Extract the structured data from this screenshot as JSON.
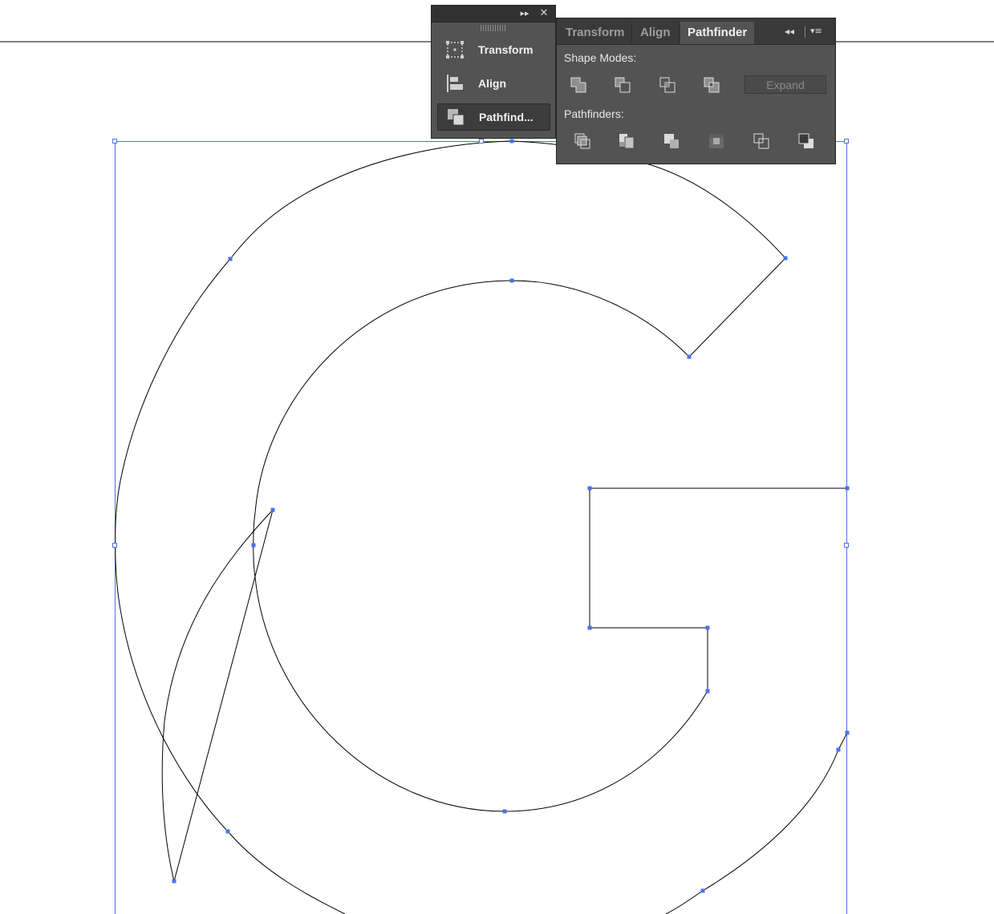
{
  "dock": {
    "items": [
      {
        "label": "Transform",
        "icon": "transform-icon"
      },
      {
        "label": "Align",
        "icon": "align-icon"
      },
      {
        "label": "Pathfind...",
        "icon": "pathfinder-icon"
      }
    ],
    "active_index": 2
  },
  "pathfinder_panel": {
    "tabs": [
      "Transform",
      "Align",
      "Pathfinder"
    ],
    "active_tab": "Pathfinder",
    "shape_modes_label": "Shape Modes:",
    "pathfinders_label": "Pathfinders:",
    "expand_label": "Expand",
    "shape_mode_icons": [
      "unite-icon",
      "minus-front-icon",
      "intersect-icon",
      "exclude-icon"
    ],
    "pathfinder_icons": [
      "divide-icon",
      "trim-icon",
      "merge-icon",
      "crop-icon",
      "outline-icon",
      "minus-back-icon"
    ]
  },
  "colors": {
    "panel_bg": "#535353",
    "panel_dark": "#323232",
    "selection_blue": "#4a72e8",
    "path_stroke": "#000000"
  }
}
